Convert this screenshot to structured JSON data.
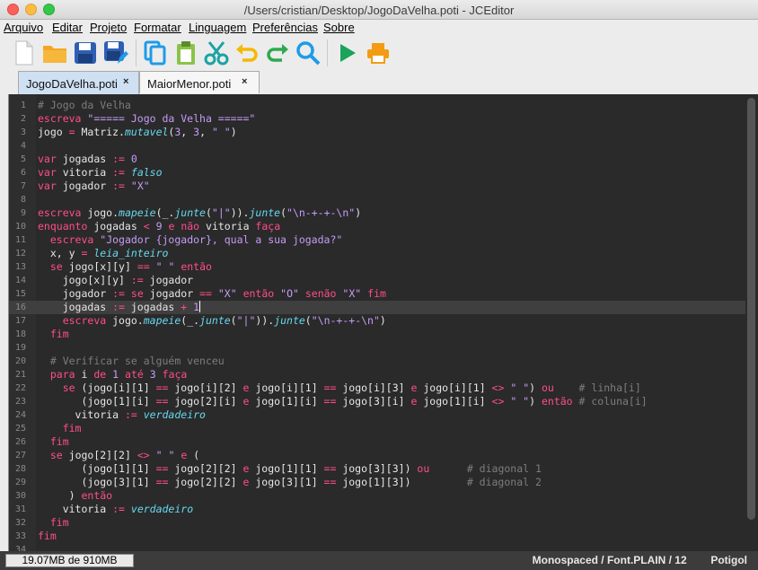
{
  "window": {
    "title": "/Users/cristian/Desktop/JogoDaVelha.poti - JCEditor"
  },
  "menu": [
    "Arquivo",
    "Editar",
    "Projeto",
    "Formatar",
    "Linguagem",
    "Preferências",
    "Sobre"
  ],
  "toolbar": [
    {
      "name": "new-file-icon",
      "color": "#ffffff"
    },
    {
      "name": "open-folder-icon",
      "color": "#f5a623"
    },
    {
      "name": "save-icon",
      "color": "#2f5fb3"
    },
    {
      "name": "save-as-icon",
      "color": "#2f5fb3"
    },
    {
      "name": "copy-icon",
      "color": "#1e9be8"
    },
    {
      "name": "paste-icon",
      "color": "#8bc34a"
    },
    {
      "name": "cut-icon",
      "color": "#1aa3a3"
    },
    {
      "name": "undo-icon",
      "color": "#f5b800"
    },
    {
      "name": "redo-icon",
      "color": "#2fa84f"
    },
    {
      "name": "search-icon",
      "color": "#1e9be8"
    },
    {
      "name": "run-icon",
      "color": "#1aa35a"
    },
    {
      "name": "print-icon",
      "color": "#f39c12"
    }
  ],
  "tabs": [
    {
      "label": "JogoDaVelha.poti",
      "active": true,
      "close": "×"
    },
    {
      "label": "MaiorMenor.poti",
      "active": false,
      "close": "×"
    }
  ],
  "editor": {
    "current_line": 16,
    "lines": [
      [
        [
          "c",
          "# Jogo da Velha"
        ]
      ],
      [
        [
          "k",
          "escreva"
        ],
        [
          "t",
          " "
        ],
        [
          "s",
          "\"===== Jogo da Velha =====\""
        ]
      ],
      [
        [
          "t",
          "jogo "
        ],
        [
          "o",
          "="
        ],
        [
          "t",
          " Matriz."
        ],
        [
          "f",
          "mutavel"
        ],
        [
          "t",
          "("
        ],
        [
          "n",
          "3"
        ],
        [
          "t",
          ", "
        ],
        [
          "n",
          "3"
        ],
        [
          "t",
          ", "
        ],
        [
          "s",
          "\" \""
        ],
        [
          "t",
          ")"
        ]
      ],
      [],
      [
        [
          "k",
          "var"
        ],
        [
          "t",
          " jogadas "
        ],
        [
          "o",
          ":="
        ],
        [
          "t",
          " "
        ],
        [
          "n",
          "0"
        ]
      ],
      [
        [
          "k",
          "var"
        ],
        [
          "t",
          " vitoria "
        ],
        [
          "o",
          ":="
        ],
        [
          "t",
          " "
        ],
        [
          "f",
          "falso"
        ]
      ],
      [
        [
          "k",
          "var"
        ],
        [
          "t",
          " jogador "
        ],
        [
          "o",
          ":="
        ],
        [
          "t",
          " "
        ],
        [
          "s",
          "\"X\""
        ]
      ],
      [],
      [
        [
          "k",
          "escreva"
        ],
        [
          "t",
          " jogo."
        ],
        [
          "f",
          "mapeie"
        ],
        [
          "t",
          "(_."
        ],
        [
          "f",
          "junte"
        ],
        [
          "t",
          "("
        ],
        [
          "s",
          "\"|\""
        ],
        [
          "t",
          "))."
        ],
        [
          "f",
          "junte"
        ],
        [
          "t",
          "("
        ],
        [
          "s",
          "\"\\n-+-+-\\n\""
        ],
        [
          "t",
          ")"
        ]
      ],
      [
        [
          "k",
          "enquanto"
        ],
        [
          "t",
          " jogadas "
        ],
        [
          "o",
          "<"
        ],
        [
          "t",
          " "
        ],
        [
          "n",
          "9"
        ],
        [
          "t",
          " "
        ],
        [
          "k",
          "e"
        ],
        [
          "t",
          " "
        ],
        [
          "k",
          "não"
        ],
        [
          "t",
          " vitoria "
        ],
        [
          "k",
          "faça"
        ]
      ],
      [
        [
          "t",
          "  "
        ],
        [
          "k",
          "escreva"
        ],
        [
          "t",
          " "
        ],
        [
          "s",
          "\"Jogador {jogador}, qual a sua jogada?\""
        ]
      ],
      [
        [
          "t",
          "  x, y "
        ],
        [
          "o",
          "="
        ],
        [
          "t",
          " "
        ],
        [
          "f",
          "leia_inteiro"
        ]
      ],
      [
        [
          "t",
          "  "
        ],
        [
          "k",
          "se"
        ],
        [
          "t",
          " jogo[x][y] "
        ],
        [
          "o",
          "=="
        ],
        [
          "t",
          " "
        ],
        [
          "s",
          "\" \""
        ],
        [
          "t",
          " "
        ],
        [
          "k",
          "então"
        ]
      ],
      [
        [
          "t",
          "    jogo[x][y] "
        ],
        [
          "o",
          ":="
        ],
        [
          "t",
          " jogador"
        ]
      ],
      [
        [
          "t",
          "    jogador "
        ],
        [
          "o",
          ":="
        ],
        [
          "t",
          " "
        ],
        [
          "k",
          "se"
        ],
        [
          "t",
          " jogador "
        ],
        [
          "o",
          "=="
        ],
        [
          "t",
          " "
        ],
        [
          "s",
          "\"X\""
        ],
        [
          "t",
          " "
        ],
        [
          "k",
          "então"
        ],
        [
          "t",
          " "
        ],
        [
          "s",
          "\"O\""
        ],
        [
          "t",
          " "
        ],
        [
          "k",
          "senão"
        ],
        [
          "t",
          " "
        ],
        [
          "s",
          "\"X\""
        ],
        [
          "t",
          " "
        ],
        [
          "k",
          "fim"
        ]
      ],
      [
        [
          "t",
          "    jogadas "
        ],
        [
          "o",
          ":="
        ],
        [
          "t",
          " jogadas "
        ],
        [
          "o",
          "+"
        ],
        [
          "t",
          " "
        ],
        [
          "n",
          "1"
        ]
      ],
      [
        [
          "t",
          "    "
        ],
        [
          "k",
          "escreva"
        ],
        [
          "t",
          " jogo."
        ],
        [
          "f",
          "mapeie"
        ],
        [
          "t",
          "(_."
        ],
        [
          "f",
          "junte"
        ],
        [
          "t",
          "("
        ],
        [
          "s",
          "\"|\""
        ],
        [
          "t",
          "))."
        ],
        [
          "f",
          "junte"
        ],
        [
          "t",
          "("
        ],
        [
          "s",
          "\"\\n-+-+-\\n\""
        ],
        [
          "t",
          ")"
        ]
      ],
      [
        [
          "t",
          "  "
        ],
        [
          "k",
          "fim"
        ]
      ],
      [],
      [
        [
          "t",
          "  "
        ],
        [
          "c",
          "# Verificar se alguém venceu"
        ]
      ],
      [
        [
          "t",
          "  "
        ],
        [
          "k",
          "para"
        ],
        [
          "t",
          " i "
        ],
        [
          "k",
          "de"
        ],
        [
          "t",
          " "
        ],
        [
          "n",
          "1"
        ],
        [
          "t",
          " "
        ],
        [
          "k",
          "até"
        ],
        [
          "t",
          " "
        ],
        [
          "n",
          "3"
        ],
        [
          "t",
          " "
        ],
        [
          "k",
          "faça"
        ]
      ],
      [
        [
          "t",
          "    "
        ],
        [
          "k",
          "se"
        ],
        [
          "t",
          " (jogo[i][1] "
        ],
        [
          "o",
          "=="
        ],
        [
          "t",
          " jogo[i][2] "
        ],
        [
          "k",
          "e"
        ],
        [
          "t",
          " jogo[i][1] "
        ],
        [
          "o",
          "=="
        ],
        [
          "t",
          " jogo[i][3] "
        ],
        [
          "k",
          "e"
        ],
        [
          "t",
          " jogo[i][1] "
        ],
        [
          "o",
          "<>"
        ],
        [
          "t",
          " "
        ],
        [
          "s",
          "\" \""
        ],
        [
          "t",
          ") "
        ],
        [
          "k",
          "ou"
        ],
        [
          "t",
          "    "
        ],
        [
          "c",
          "# linha[i]"
        ]
      ],
      [
        [
          "t",
          "       (jogo[1][i] "
        ],
        [
          "o",
          "=="
        ],
        [
          "t",
          " jogo[2][i] "
        ],
        [
          "k",
          "e"
        ],
        [
          "t",
          " jogo[1][i] "
        ],
        [
          "o",
          "=="
        ],
        [
          "t",
          " jogo[3][i] "
        ],
        [
          "k",
          "e"
        ],
        [
          "t",
          " jogo[1][i] "
        ],
        [
          "o",
          "<>"
        ],
        [
          "t",
          " "
        ],
        [
          "s",
          "\" \""
        ],
        [
          "t",
          ") "
        ],
        [
          "k",
          "então"
        ],
        [
          "t",
          " "
        ],
        [
          "c",
          "# coluna[i]"
        ]
      ],
      [
        [
          "t",
          "      vitoria "
        ],
        [
          "o",
          ":="
        ],
        [
          "t",
          " "
        ],
        [
          "f",
          "verdadeiro"
        ]
      ],
      [
        [
          "t",
          "    "
        ],
        [
          "k",
          "fim"
        ]
      ],
      [
        [
          "t",
          "  "
        ],
        [
          "k",
          "fim"
        ]
      ],
      [
        [
          "t",
          "  "
        ],
        [
          "k",
          "se"
        ],
        [
          "t",
          " jogo[2][2] "
        ],
        [
          "o",
          "<>"
        ],
        [
          "t",
          " "
        ],
        [
          "s",
          "\" \""
        ],
        [
          "t",
          " "
        ],
        [
          "k",
          "e"
        ],
        [
          "t",
          " ("
        ]
      ],
      [
        [
          "t",
          "       (jogo[1][1] "
        ],
        [
          "o",
          "=="
        ],
        [
          "t",
          " jogo[2][2] "
        ],
        [
          "k",
          "e"
        ],
        [
          "t",
          " jogo[1][1] "
        ],
        [
          "o",
          "=="
        ],
        [
          "t",
          " jogo[3][3]) "
        ],
        [
          "k",
          "ou"
        ],
        [
          "t",
          "      "
        ],
        [
          "c",
          "# diagonal 1"
        ]
      ],
      [
        [
          "t",
          "       (jogo[3][1] "
        ],
        [
          "o",
          "=="
        ],
        [
          "t",
          " jogo[2][2] "
        ],
        [
          "k",
          "e"
        ],
        [
          "t",
          " jogo[3][1] "
        ],
        [
          "o",
          "=="
        ],
        [
          "t",
          " jogo[1][3])         "
        ],
        [
          "c",
          "# diagonal 2"
        ]
      ],
      [
        [
          "t",
          "     ) "
        ],
        [
          "k",
          "então"
        ]
      ],
      [
        [
          "t",
          "    vitoria "
        ],
        [
          "o",
          ":="
        ],
        [
          "t",
          " "
        ],
        [
          "f",
          "verdadeiro"
        ]
      ],
      [
        [
          "t",
          "  "
        ],
        [
          "k",
          "fim"
        ]
      ],
      [
        [
          "k",
          "fim"
        ]
      ],
      []
    ]
  },
  "status": {
    "memory": "19.07MB de 910MB",
    "font": "Monospaced / Font.PLAIN / 12",
    "language": "Potigol"
  }
}
